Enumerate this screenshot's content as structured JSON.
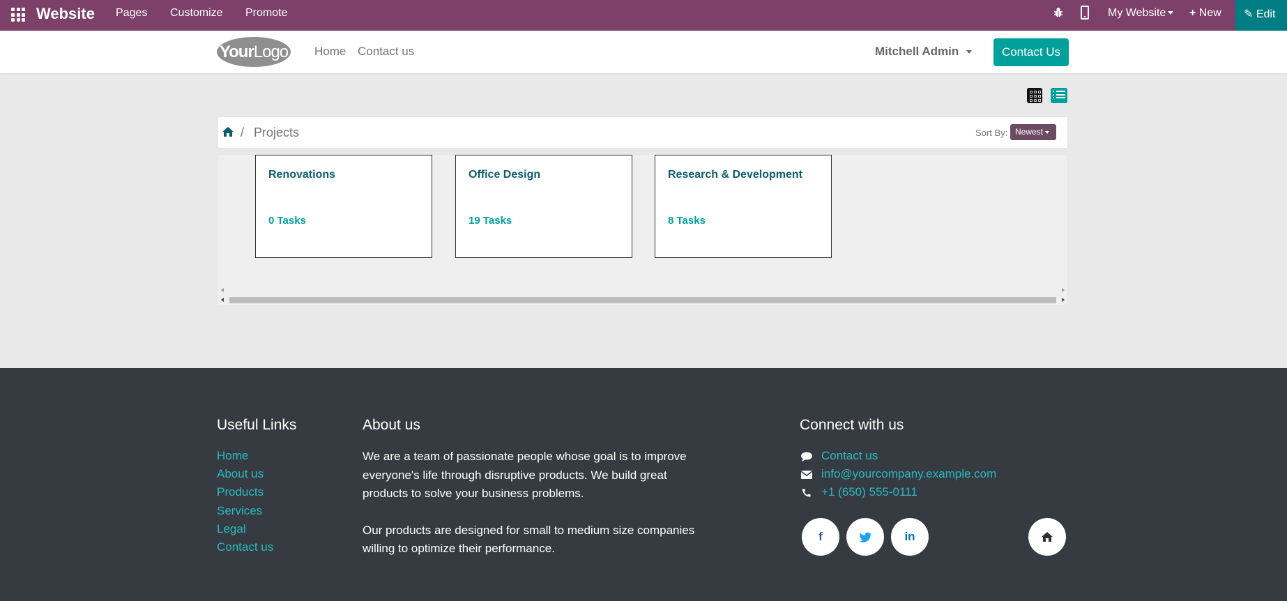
{
  "topbar": {
    "brand": "Website",
    "menu": [
      "Pages",
      "Customize",
      "Promote"
    ],
    "my_website": "My Website",
    "new_label": "New",
    "edit_label": "Edit"
  },
  "header": {
    "logo_text_bold": "Your",
    "logo_text": "Logo",
    "nav": [
      "Home",
      "Contact us"
    ],
    "user": "Mitchell Admin",
    "contact_button": "Contact Us"
  },
  "breadcrumb": {
    "separator": "/",
    "current": "Projects",
    "sort_label": "Sort By:",
    "sort_value": "Newest"
  },
  "projects": [
    {
      "name": "Renovations",
      "tasks": "0 Tasks"
    },
    {
      "name": "Office Design",
      "tasks": "19 Tasks"
    },
    {
      "name": "Research & Development",
      "tasks": "8 Tasks"
    }
  ],
  "footer": {
    "useful_links_title": "Useful Links",
    "useful_links": [
      "Home",
      "About us",
      "Products",
      "Services",
      "Legal",
      "Contact us"
    ],
    "about_title": "About us",
    "about_p1": "We are a team of passionate people whose goal is to improve everyone's life through disruptive products. We build great products to solve your business problems.",
    "about_p2": "Our products are designed for small to medium size companies willing to optimize their performance.",
    "connect_title": "Connect with us",
    "contact_link": "Contact us",
    "email": "info@yourcompany.example.com",
    "phone": "+1 (650) 555-0111",
    "social": [
      "f",
      "twitter-icon",
      "in"
    ]
  },
  "colors": {
    "topbar": "#7c4069",
    "accent": "#01a09a",
    "footer": "#363b42"
  }
}
